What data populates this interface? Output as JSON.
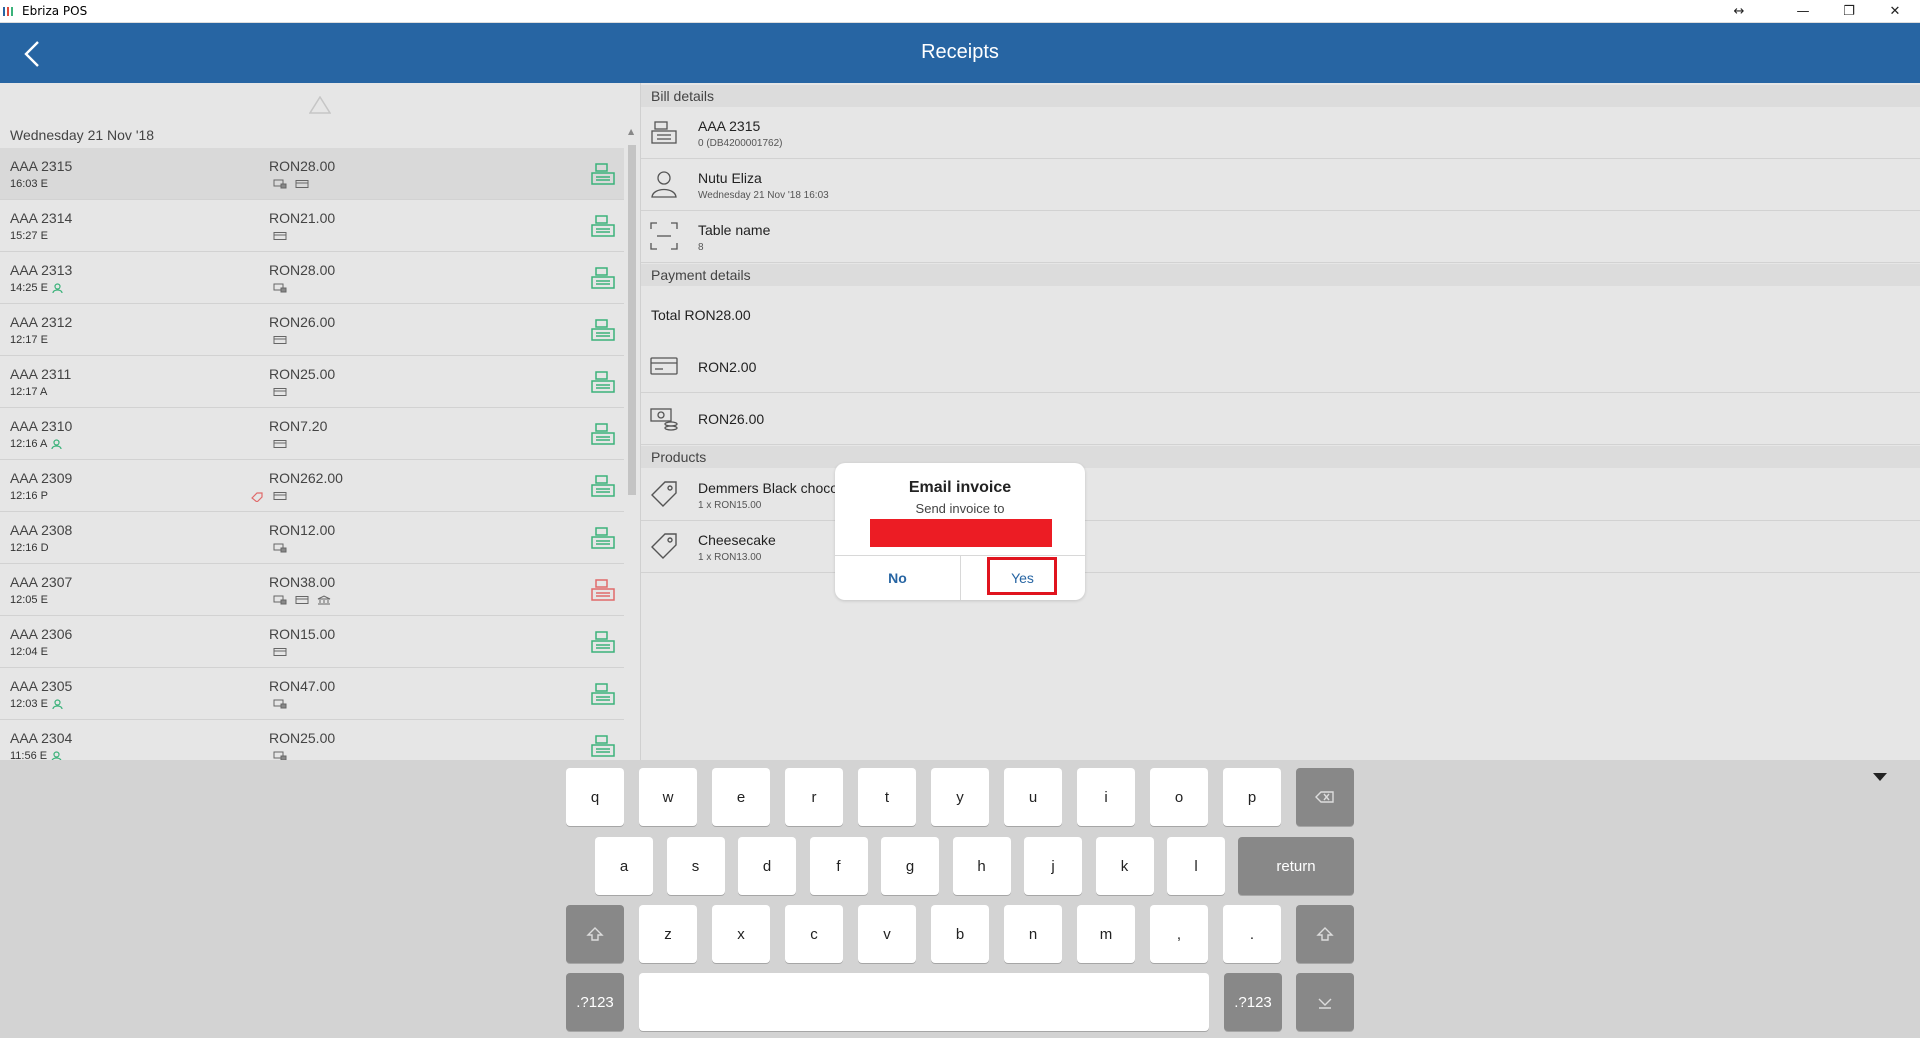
{
  "window": {
    "app_title": "Ebriza POS",
    "controls": [
      "↔",
      "—",
      "❐",
      "✕"
    ]
  },
  "header": {
    "title": "Receipts",
    "back_icon": "chevron-left-icon"
  },
  "list": {
    "date_label": "Wednesday 21 Nov '18",
    "receipts": [
      {
        "number": "AAA 2315",
        "time": "16:03 E",
        "amount": "RON28.00",
        "icons": [
          "cash",
          "card"
        ],
        "user_icon": false,
        "discount": false,
        "status": "ok",
        "selected": true
      },
      {
        "number": "AAA 2314",
        "time": "15:27 E",
        "amount": "RON21.00",
        "icons": [
          "card"
        ],
        "user_icon": false,
        "discount": false,
        "status": "ok",
        "selected": false
      },
      {
        "number": "AAA 2313",
        "time": "14:25 E",
        "amount": "RON28.00",
        "icons": [
          "cash"
        ],
        "user_icon": true,
        "discount": false,
        "status": "ok",
        "selected": false
      },
      {
        "number": "AAA 2312",
        "time": "12:17 E",
        "amount": "RON26.00",
        "icons": [
          "card"
        ],
        "user_icon": false,
        "discount": false,
        "status": "ok",
        "selected": false
      },
      {
        "number": "AAA 2311",
        "time": "12:17 A",
        "amount": "RON25.00",
        "icons": [
          "card"
        ],
        "user_icon": false,
        "discount": false,
        "status": "ok",
        "selected": false
      },
      {
        "number": "AAA 2310",
        "time": "12:16 A",
        "amount": "RON7.20",
        "icons": [
          "card"
        ],
        "user_icon": true,
        "discount": false,
        "status": "ok",
        "selected": false
      },
      {
        "number": "AAA 2309",
        "time": "12:16 P",
        "amount": "RON262.00",
        "icons": [
          "card"
        ],
        "user_icon": false,
        "discount": true,
        "status": "ok",
        "selected": false
      },
      {
        "number": "AAA 2308",
        "time": "12:16 D",
        "amount": "RON12.00",
        "icons": [
          "cash"
        ],
        "user_icon": false,
        "discount": false,
        "status": "ok",
        "selected": false
      },
      {
        "number": "AAA 2307",
        "time": "12:05 E",
        "amount": "RON38.00",
        "icons": [
          "cash",
          "card",
          "bank"
        ],
        "user_icon": false,
        "discount": false,
        "status": "error",
        "selected": false
      },
      {
        "number": "AAA 2306",
        "time": "12:04 E",
        "amount": "RON15.00",
        "icons": [
          "card"
        ],
        "user_icon": false,
        "discount": false,
        "status": "ok",
        "selected": false
      },
      {
        "number": "AAA 2305",
        "time": "12:03 E",
        "amount": "RON47.00",
        "icons": [
          "cash"
        ],
        "user_icon": true,
        "discount": false,
        "status": "ok",
        "selected": false
      },
      {
        "number": "AAA 2304",
        "time": "11:56 E",
        "amount": "RON25.00",
        "icons": [
          "cash"
        ],
        "user_icon": true,
        "discount": false,
        "status": "ok",
        "selected": false
      }
    ]
  },
  "details": {
    "bill_section": "Bill details",
    "bill": {
      "number": "AAA 2315",
      "fiscal": "0 (DB4200001762)"
    },
    "user": {
      "name": "Nutu Eliza",
      "datetime": "Wednesday 21 Nov '18 16:03"
    },
    "table": {
      "label": "Table name",
      "value": "8"
    },
    "payment_section": "Payment details",
    "total": "Total RON28.00",
    "payments": [
      {
        "method": "card",
        "amount": "RON2.00"
      },
      {
        "method": "cash",
        "amount": "RON26.00"
      }
    ],
    "products_section": "Products",
    "products": [
      {
        "name": "Demmers Black chocolate",
        "qty": "1 x RON15.00"
      },
      {
        "name": "Cheesecake",
        "qty": "1 x RON13.00"
      }
    ]
  },
  "dialog": {
    "title": "Email invoice",
    "subtitle": "Send invoice to",
    "no_label": "No",
    "yes_label": "Yes"
  },
  "keyboard": {
    "row1": [
      "q",
      "w",
      "e",
      "r",
      "t",
      "y",
      "u",
      "i",
      "o",
      "p"
    ],
    "row2": [
      "a",
      "s",
      "d",
      "f",
      "g",
      "h",
      "j",
      "k",
      "l"
    ],
    "row3": [
      "z",
      "x",
      "c",
      "v",
      "b",
      "n",
      "m",
      ",",
      "."
    ],
    "return_label": "return",
    "numeric_label": ".?123",
    "backspace_icon": "backspace-icon",
    "shift_icon": "shift-icon",
    "hide_icon": "keyboard-hide-icon"
  },
  "colors": {
    "accent": "#2765a3",
    "ok_green": "#3bb27a",
    "error_red": "#e06a6a",
    "highlight": "#e0141e"
  }
}
